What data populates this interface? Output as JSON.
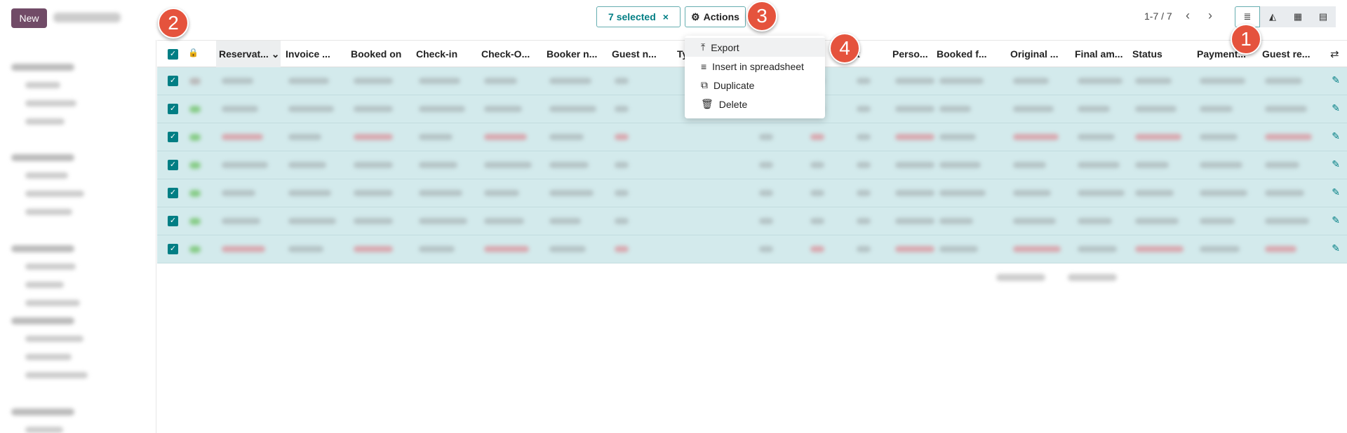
{
  "header": {
    "new_label": "New",
    "selected_label": "7 selected",
    "clear_icon": "×",
    "actions_label": "Actions",
    "pager": "1-7 / 7"
  },
  "views": [
    {
      "icon": "list-icon",
      "glyph": "≣"
    },
    {
      "icon": "graph-icon",
      "glyph": "◭"
    },
    {
      "icon": "calendar-icon",
      "glyph": "▦"
    },
    {
      "icon": "pivot-icon",
      "glyph": "▤"
    }
  ],
  "columns": [
    "Reservat...",
    "Invoice ...",
    "Booked on",
    "Check-in",
    "Check-O...",
    "Booker n...",
    "Guest n...",
    "Ty",
    "ight",
    "Perso...",
    "Booked f...",
    "Original ...",
    "Final am...",
    "Status",
    "Payment...",
    "Guest re..."
  ],
  "actions_menu": [
    {
      "label": "Export",
      "icon": "upload-icon",
      "glyph": "⤒"
    },
    {
      "label": "Insert in spreadsheet",
      "icon": "list-icon",
      "glyph": "≡"
    },
    {
      "label": "Duplicate",
      "icon": "copy-icon",
      "glyph": "⧉"
    },
    {
      "label": "Delete",
      "icon": "trash-icon",
      "glyph": "🗑"
    }
  ],
  "row_count": 7,
  "callouts": [
    "1",
    "2",
    "3",
    "4"
  ],
  "colors": {
    "brand": "#714b67",
    "accent": "#017e84",
    "selected_row": "#d3eaec",
    "callout": "#e5533d"
  }
}
